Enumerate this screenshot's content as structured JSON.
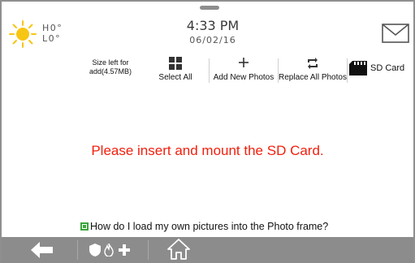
{
  "weather": {
    "icon": "sun-icon",
    "high": "H0°",
    "low": "L0°",
    "sun_color": "#f7c614"
  },
  "clock": {
    "time": "4:33 PM",
    "date": "06/02/16"
  },
  "header": {
    "mail_icon": "mail-icon"
  },
  "toolbar": {
    "size_left": "Size left for add(4.57MB)",
    "items": [
      {
        "label": "Select All",
        "icon": "grid-icon"
      },
      {
        "label": "Add New Photos",
        "icon": "plus-icon"
      },
      {
        "label": "Replace All Photos",
        "icon": "replace-icon"
      },
      {
        "label": "SD Card",
        "icon": "sd-card-icon"
      }
    ]
  },
  "main": {
    "message": "Please insert and mount the SD Card.",
    "message_color": "#f21e0c",
    "help_link": "How do I load my own pictures into the Photo frame?"
  },
  "bottom_bar": {
    "back_icon": "back-arrow-icon",
    "emergency_icons": [
      "shield-icon",
      "fire-icon",
      "medical-cross-icon"
    ],
    "home_icon": "home-icon"
  }
}
